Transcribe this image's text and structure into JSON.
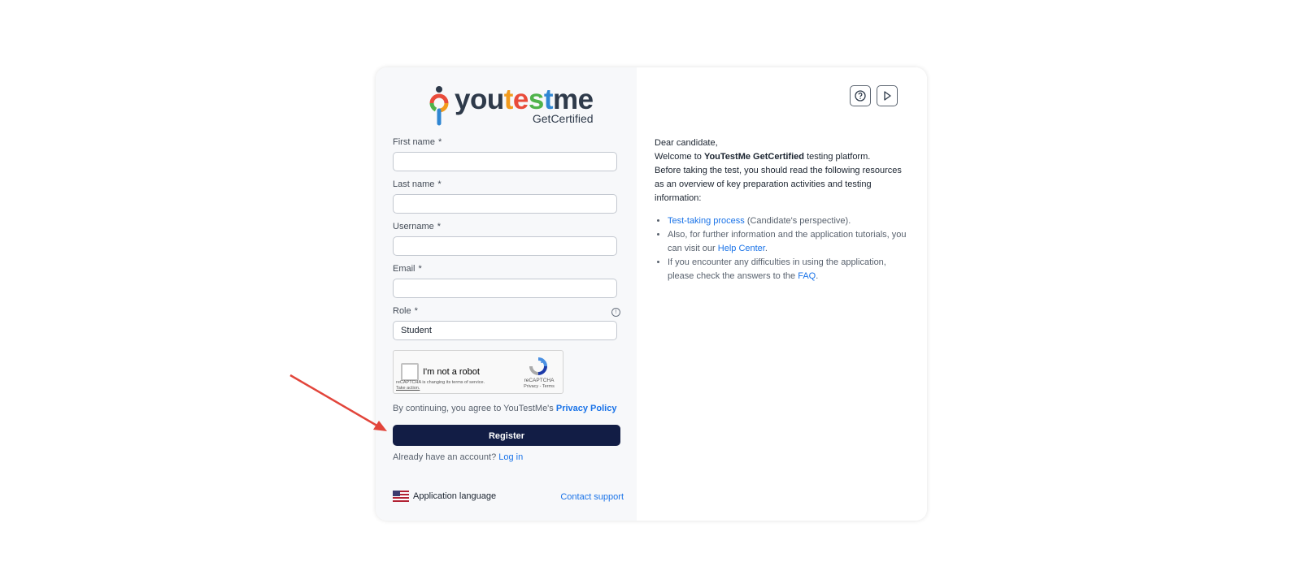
{
  "logo": {
    "word_parts": [
      "you",
      "t",
      "e",
      "s",
      "t",
      "me"
    ],
    "sub": "GetCertified"
  },
  "form": {
    "first_name_label": "First name",
    "last_name_label": "Last name",
    "username_label": "Username",
    "email_label": "Email",
    "role_label": "Role",
    "required_mark": "*",
    "role_value": "Student",
    "first_name_value": "",
    "last_name_value": "",
    "username_value": "",
    "email_value": ""
  },
  "captcha": {
    "label": "I'm not a robot",
    "notice": "reCAPTCHA is changing its terms of service.",
    "action": "Take action.",
    "brand": "reCAPTCHA",
    "links": "Privacy - Terms"
  },
  "agree": {
    "text": "By continuing, you agree to YouTestMe's",
    "link": "Privacy Policy"
  },
  "register_label": "Register",
  "login": {
    "text": "Already have an account?",
    "link": "Log in"
  },
  "footer": {
    "language_label": "Application language",
    "support_label": "Contact support"
  },
  "intro": {
    "greeting": "Dear candidate,",
    "welcome_prefix": "Welcome to",
    "platform_name": "YouTestMe GetCertified",
    "welcome_suffix": "testing platform.",
    "before": "Before taking the test, you should read the following resources as an overview of key preparation activities and testing information:",
    "items": [
      {
        "link": "Test-taking process",
        "text": "(Candidate's perspective)."
      },
      {
        "text": "Also, for further information and the application tutorials, you can visit our",
        "link": "Help Center",
        "end": "."
      },
      {
        "text": "If you encounter any difficulties in using the application, please check the answers to the",
        "link": "FAQ",
        "end": "."
      }
    ]
  },
  "colors": {
    "primary_button": "#121d45",
    "link": "#1a73e8",
    "arrow": "#e2453b"
  }
}
